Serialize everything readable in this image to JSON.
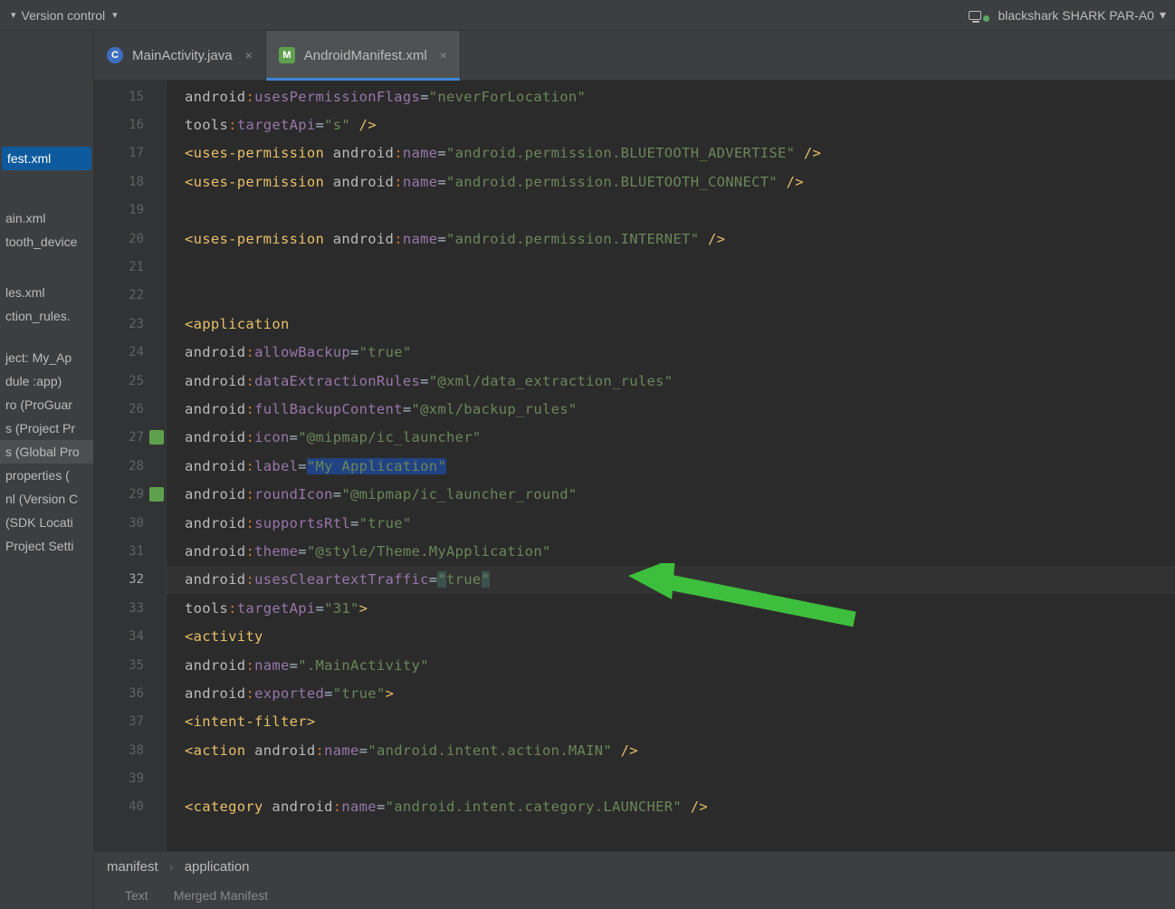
{
  "topbar": {
    "menu_item": "Version control",
    "device": "blackshark SHARK PAR-A0"
  },
  "tabs": [
    {
      "label": "MainActivity.java",
      "icon": "C",
      "active": false
    },
    {
      "label": "AndroidManifest.xml",
      "icon": "M",
      "active": true
    }
  ],
  "sidebar": {
    "items": [
      {
        "label": "fest.xml",
        "sel": true
      },
      {
        "label": ""
      },
      {
        "label": ""
      },
      {
        "label": ""
      },
      {
        "label": ""
      },
      {
        "label": "ain.xml"
      },
      {
        "label": "tooth_device"
      },
      {
        "label": ""
      },
      {
        "label": ""
      },
      {
        "label": ""
      },
      {
        "label": "les.xml"
      },
      {
        "label": "ction_rules."
      },
      {
        "label": ""
      },
      {
        "label": ""
      },
      {
        "label": "ject: My_Ap"
      },
      {
        "label": "dule :app)"
      },
      {
        "label": "ro (ProGuar"
      },
      {
        "label": "s (Project Pr"
      },
      {
        "label": "s (Global Pro",
        "hl": true
      },
      {
        "label": "properties ("
      },
      {
        "label": "nl (Version C"
      },
      {
        "label": "(SDK Locati"
      },
      {
        "label": "Project Setti"
      }
    ]
  },
  "gutter": {
    "start": 15,
    "end": 40,
    "current": 32,
    "icons": [
      27,
      29
    ]
  },
  "code": {
    "lines": [
      {
        "indent": 3,
        "tokens": [
          {
            "t": "ns",
            "v": "android"
          },
          {
            "t": "colon",
            "v": ":"
          },
          {
            "t": "attr",
            "v": "usesPermissionFlags"
          },
          {
            "t": "eq",
            "v": "="
          },
          {
            "t": "str",
            "v": "\"neverForLocation\""
          }
        ]
      },
      {
        "indent": 3,
        "tokens": [
          {
            "t": "ns",
            "v": "tools"
          },
          {
            "t": "colon",
            "v": ":"
          },
          {
            "t": "attr",
            "v": "targetApi"
          },
          {
            "t": "eq",
            "v": "="
          },
          {
            "t": "str",
            "v": "\"s\""
          },
          {
            "t": "tag",
            "v": " />"
          }
        ]
      },
      {
        "indent": 1,
        "tokens": [
          {
            "t": "tag",
            "v": "<uses-permission "
          },
          {
            "t": "ns",
            "v": "android"
          },
          {
            "t": "colon",
            "v": ":"
          },
          {
            "t": "attr",
            "v": "name"
          },
          {
            "t": "eq",
            "v": "="
          },
          {
            "t": "str",
            "v": "\"android.permission.BLUETOOTH_ADVERTISE\""
          },
          {
            "t": "tag",
            "v": " />"
          }
        ]
      },
      {
        "indent": 1,
        "tokens": [
          {
            "t": "tag",
            "v": "<uses-permission "
          },
          {
            "t": "ns",
            "v": "android"
          },
          {
            "t": "colon",
            "v": ":"
          },
          {
            "t": "attr",
            "v": "name"
          },
          {
            "t": "eq",
            "v": "="
          },
          {
            "t": "str",
            "v": "\"android.permission.BLUETOOTH_CONNECT\""
          },
          {
            "t": "tag",
            "v": " />"
          }
        ]
      },
      {
        "indent": 0,
        "tokens": []
      },
      {
        "indent": 1,
        "tokens": [
          {
            "t": "tag",
            "v": "<uses-permission "
          },
          {
            "t": "ns",
            "v": "android"
          },
          {
            "t": "colon",
            "v": ":"
          },
          {
            "t": "attr",
            "v": "name"
          },
          {
            "t": "eq",
            "v": "="
          },
          {
            "t": "str",
            "v": "\"android.permission.INTERNET\""
          },
          {
            "t": "tag",
            "v": " />"
          }
        ]
      },
      {
        "indent": 0,
        "tokens": []
      },
      {
        "indent": 0,
        "tokens": []
      },
      {
        "indent": 1,
        "tokens": [
          {
            "t": "tag",
            "v": "<application"
          }
        ]
      },
      {
        "indent": 3,
        "tokens": [
          {
            "t": "ns",
            "v": "android"
          },
          {
            "t": "colon",
            "v": ":"
          },
          {
            "t": "attr",
            "v": "allowBackup"
          },
          {
            "t": "eq",
            "v": "="
          },
          {
            "t": "str",
            "v": "\"true\""
          }
        ]
      },
      {
        "indent": 3,
        "tokens": [
          {
            "t": "ns",
            "v": "android"
          },
          {
            "t": "colon",
            "v": ":"
          },
          {
            "t": "attr",
            "v": "dataExtractionRules"
          },
          {
            "t": "eq",
            "v": "="
          },
          {
            "t": "str",
            "v": "\"@xml/data_extraction_rules\""
          }
        ]
      },
      {
        "indent": 3,
        "tokens": [
          {
            "t": "ns",
            "v": "android"
          },
          {
            "t": "colon",
            "v": ":"
          },
          {
            "t": "attr",
            "v": "fullBackupContent"
          },
          {
            "t": "eq",
            "v": "="
          },
          {
            "t": "str",
            "v": "\"@xml/backup_rules\""
          }
        ]
      },
      {
        "indent": 3,
        "tokens": [
          {
            "t": "ns",
            "v": "android"
          },
          {
            "t": "colon",
            "v": ":"
          },
          {
            "t": "attr",
            "v": "icon"
          },
          {
            "t": "eq",
            "v": "="
          },
          {
            "t": "str",
            "v": "\"@mipmap/ic_launcher\""
          }
        ]
      },
      {
        "indent": 3,
        "tokens": [
          {
            "t": "ns",
            "v": "android"
          },
          {
            "t": "colon",
            "v": ":"
          },
          {
            "t": "attr",
            "v": "label"
          },
          {
            "t": "eq",
            "v": "="
          },
          {
            "t": "str-hl",
            "v": "\"My Application\""
          }
        ]
      },
      {
        "indent": 3,
        "tokens": [
          {
            "t": "ns",
            "v": "android"
          },
          {
            "t": "colon",
            "v": ":"
          },
          {
            "t": "attr",
            "v": "roundIcon"
          },
          {
            "t": "eq",
            "v": "="
          },
          {
            "t": "str",
            "v": "\"@mipmap/ic_launcher_round\""
          }
        ]
      },
      {
        "indent": 3,
        "tokens": [
          {
            "t": "ns",
            "v": "android"
          },
          {
            "t": "colon",
            "v": ":"
          },
          {
            "t": "attr",
            "v": "supportsRtl"
          },
          {
            "t": "eq",
            "v": "="
          },
          {
            "t": "str",
            "v": "\"true\""
          }
        ]
      },
      {
        "indent": 3,
        "tokens": [
          {
            "t": "ns",
            "v": "android"
          },
          {
            "t": "colon",
            "v": ":"
          },
          {
            "t": "attr",
            "v": "theme"
          },
          {
            "t": "eq",
            "v": "="
          },
          {
            "t": "str",
            "v": "\"@style/Theme.MyApplication\""
          }
        ]
      },
      {
        "indent": 3,
        "highlight": true,
        "tokens": [
          {
            "t": "ns",
            "v": "android"
          },
          {
            "t": "colon",
            "v": ":"
          },
          {
            "t": "attr",
            "v": "usesCleartextTraffic"
          },
          {
            "t": "eq",
            "v": "="
          },
          {
            "t": "quote-hl",
            "v": "\""
          },
          {
            "t": "str",
            "v": "true"
          },
          {
            "t": "quote-hl",
            "v": "\""
          }
        ]
      },
      {
        "indent": 3,
        "tokens": [
          {
            "t": "ns",
            "v": "tools"
          },
          {
            "t": "colon",
            "v": ":"
          },
          {
            "t": "attr",
            "v": "targetApi"
          },
          {
            "t": "eq",
            "v": "="
          },
          {
            "t": "str",
            "v": "\"31\""
          },
          {
            "t": "tag",
            "v": ">"
          }
        ]
      },
      {
        "indent": 3,
        "tokens": [
          {
            "t": "tag",
            "v": "<activity"
          }
        ]
      },
      {
        "indent": 5,
        "tokens": [
          {
            "t": "ns",
            "v": "android"
          },
          {
            "t": "colon",
            "v": ":"
          },
          {
            "t": "attr",
            "v": "name"
          },
          {
            "t": "eq",
            "v": "="
          },
          {
            "t": "str",
            "v": "\".MainActivity\""
          }
        ]
      },
      {
        "indent": 5,
        "tokens": [
          {
            "t": "ns",
            "v": "android"
          },
          {
            "t": "colon",
            "v": ":"
          },
          {
            "t": "attr",
            "v": "exported"
          },
          {
            "t": "eq",
            "v": "="
          },
          {
            "t": "str",
            "v": "\"true\""
          },
          {
            "t": "tag",
            "v": ">"
          }
        ]
      },
      {
        "indent": 5,
        "tokens": [
          {
            "t": "tag",
            "v": "<intent-filter>"
          }
        ]
      },
      {
        "indent": 7,
        "tokens": [
          {
            "t": "tag",
            "v": "<action "
          },
          {
            "t": "ns",
            "v": "android"
          },
          {
            "t": "colon",
            "v": ":"
          },
          {
            "t": "attr",
            "v": "name"
          },
          {
            "t": "eq",
            "v": "="
          },
          {
            "t": "str",
            "v": "\"android.intent.action.MAIN\""
          },
          {
            "t": "tag",
            "v": " />"
          }
        ]
      },
      {
        "indent": 0,
        "tokens": []
      },
      {
        "indent": 7,
        "tokens": [
          {
            "t": "tag",
            "v": "<category "
          },
          {
            "t": "ns",
            "v": "android"
          },
          {
            "t": "colon",
            "v": ":"
          },
          {
            "t": "attr",
            "v": "name"
          },
          {
            "t": "eq",
            "v": "="
          },
          {
            "t": "str",
            "v": "\"android.intent.category.LAUNCHER\""
          },
          {
            "t": "tag",
            "v": " />"
          }
        ]
      }
    ]
  },
  "breadcrumb": [
    "manifest",
    "application"
  ],
  "bottom_tabs": [
    "Text",
    "Merged Manifest"
  ]
}
